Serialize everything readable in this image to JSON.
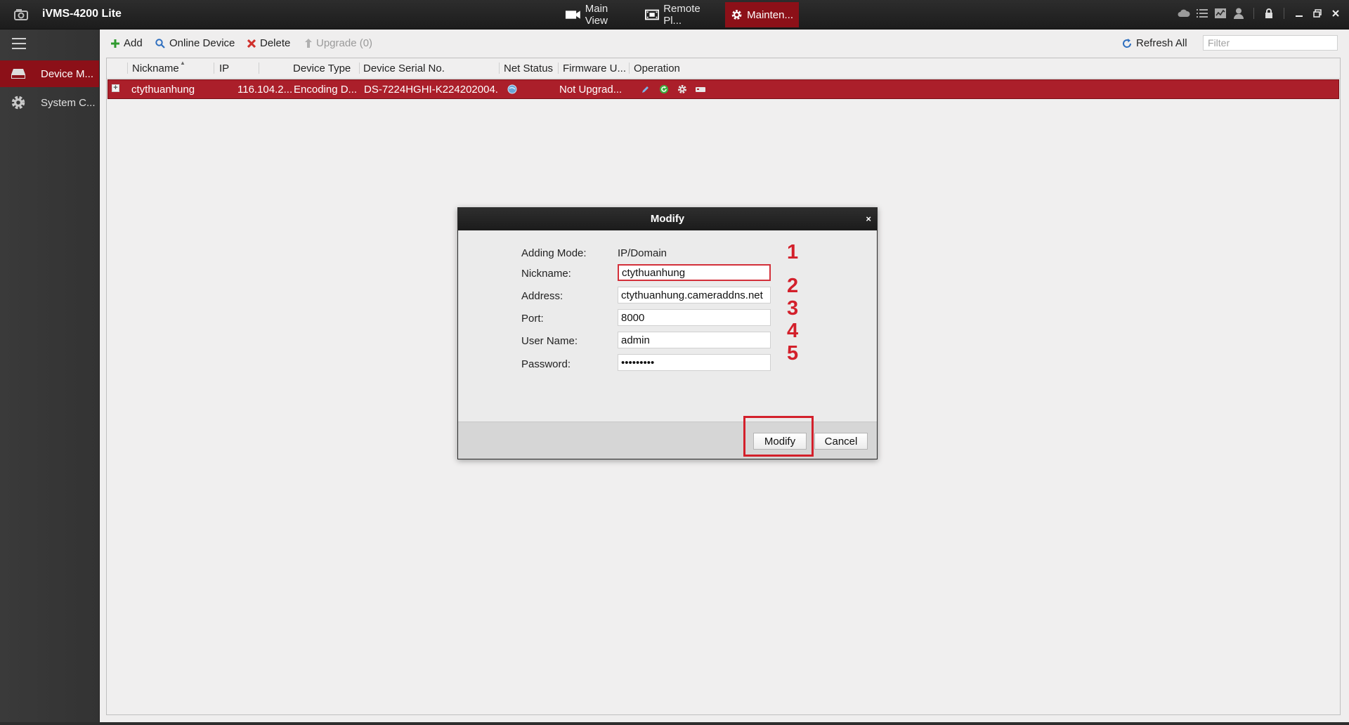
{
  "app": {
    "title": "iVMS-4200 Lite"
  },
  "top_tabs": [
    {
      "label": "Main View",
      "icon": "camera-icon"
    },
    {
      "label": "Remote Pl...",
      "icon": "film-icon"
    },
    {
      "label": "Mainten...",
      "icon": "gear-icon",
      "active": true
    }
  ],
  "sidebar": {
    "items": [
      {
        "label": "Device M...",
        "icon": "device-icon",
        "active": true
      },
      {
        "label": "System C...",
        "icon": "gear-icon"
      }
    ]
  },
  "toolbar": {
    "add_label": "Add",
    "online_device_label": "Online Device",
    "delete_label": "Delete",
    "upgrade_label": "Upgrade (0)",
    "refresh_label": "Refresh All",
    "filter_placeholder": "Filter"
  },
  "table": {
    "columns": [
      "Nickname",
      "IP",
      "Device Type",
      "Device Serial No.",
      "Net Status",
      "Firmware U...",
      "Operation"
    ],
    "rows": [
      {
        "nickname": "ctythuanhung",
        "ip": "116.104.2...",
        "device_type": "Encoding D...",
        "serial": "DS-7224HGHI-K224202004...",
        "firmware": "Not Upgrad..."
      }
    ]
  },
  "dialog": {
    "title": "Modify",
    "close_glyph": "×",
    "adding_mode_label": "Adding Mode:",
    "adding_mode_value": "IP/Domain",
    "nickname_label": "Nickname:",
    "nickname_value": "ctythuanhung",
    "address_label": "Address:",
    "address_value": "ctythuanhung.cameraddns.net",
    "port_label": "Port:",
    "port_value": "8000",
    "username_label": "User Name:",
    "username_value": "admin",
    "password_label": "Password:",
    "password_value": "123456789",
    "modify_label": "Modify",
    "cancel_label": "Cancel"
  },
  "annotations": {
    "steps": [
      "1",
      "2",
      "3",
      "4",
      "5"
    ]
  },
  "colors": {
    "accent": "#8c1018",
    "row_selected": "#ab1f2a",
    "annotation": "#d3202b"
  }
}
